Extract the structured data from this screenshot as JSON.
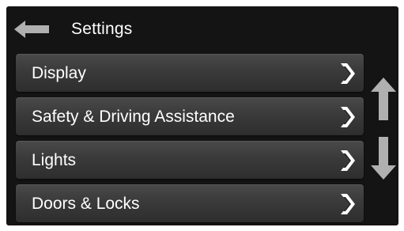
{
  "header": {
    "title": "Settings",
    "back_icon": "arrow-left-icon"
  },
  "menu": {
    "items": [
      {
        "label": "Display",
        "icon": "chevron-right-icon"
      },
      {
        "label": "Safety & Driving Assistance",
        "icon": "chevron-right-icon"
      },
      {
        "label": "Lights",
        "icon": "chevron-right-icon"
      },
      {
        "label": "Doors & Locks",
        "icon": "chevron-right-icon"
      }
    ]
  },
  "scroll": {
    "up_icon": "arrow-up-icon",
    "down_icon": "arrow-down-icon"
  },
  "colors": {
    "screen_background": "#141414",
    "item_background": "#3a3a3a",
    "text": "#ffffff",
    "arrow": "#b0b0b0"
  }
}
